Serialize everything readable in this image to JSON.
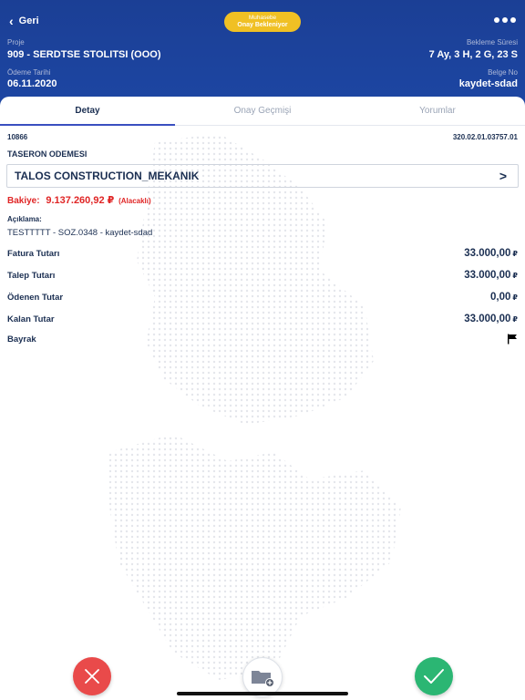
{
  "header": {
    "back_label": "Geri",
    "status_line1": "Muhasebe",
    "status_line2": "Onay Bekleniyor",
    "project_label": "Proje",
    "project_value": "909 - SERDTSE STOLITSI  (OOO)",
    "wait_label": "Bekleme Süresi",
    "wait_value": "7 Ay, 3 H, 2 G, 23 S",
    "payment_date_label": "Ödeme Tarihi",
    "payment_date_value": "06.11.2020",
    "doc_no_label": "Belge No",
    "doc_no_value": "kaydet-sdad"
  },
  "tabs": [
    {
      "label": "Detay",
      "active": true
    },
    {
      "label": "Onay Geçmişi",
      "active": false
    },
    {
      "label": "Yorumlar",
      "active": false
    }
  ],
  "detail": {
    "code_left": "10866",
    "code_right": "320.02.01.03757.01",
    "section_title": "TASERON ODEMESI",
    "supplier": "TALOS CONSTRUCTION_MEKANIK",
    "balance_label": "Bakiye:",
    "balance_amount": "9.137.260,92 ₽",
    "balance_tag": "(Alacaklı)",
    "description_label": "Açıklama:",
    "description": "TESTTTTT - SOZ.0348 - kaydet-sdad",
    "rows": [
      {
        "label": "Fatura Tutarı",
        "value": "33.000,00",
        "currency": "₽"
      },
      {
        "label": "Talep Tutarı",
        "value": "33.000,00",
        "currency": "₽"
      },
      {
        "label": "Ödenen Tutar",
        "value": "0,00",
        "currency": "₽"
      },
      {
        "label": "Kalan Tutar",
        "value": "33.000,00",
        "currency": "₽"
      }
    ],
    "flag_label": "Bayrak"
  },
  "colors": {
    "header_bg": "#1d46a3",
    "status_pill": "#f0c024",
    "reject": "#e94a4a",
    "approve": "#2bb673",
    "balance": "#e02525"
  },
  "icons": [
    "chevron-left-icon",
    "more-icon",
    "chevron-right-icon",
    "flag-icon",
    "close-icon",
    "folder-add-icon",
    "check-icon"
  ]
}
